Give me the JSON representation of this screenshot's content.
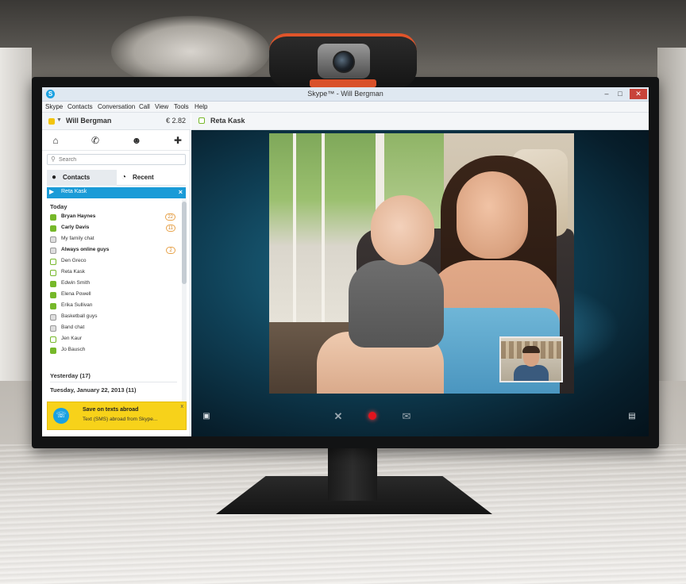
{
  "window": {
    "title": "Skype™ - Will Bergman",
    "app_icon": "skype-icon",
    "buttons": {
      "minimize": "–",
      "maximize": "□",
      "close": "✕"
    }
  },
  "menu": [
    "Skype",
    "Contacts",
    "Conversation",
    "Call",
    "View",
    "Tools",
    "Help"
  ],
  "profile": {
    "name": "Will Bergman",
    "credit": "€ 2.82",
    "status_color": "#f2c40d"
  },
  "toolbar_icons": [
    "home-icon",
    "phone-icon",
    "group-icon",
    "add-contact-icon"
  ],
  "search": {
    "placeholder": "Search"
  },
  "tabs": {
    "contacts": "Contacts",
    "recent": "Recent"
  },
  "active_chat": {
    "name": "Reta Kask"
  },
  "sections": {
    "today": "Today",
    "yesterday": "Yesterday (17)",
    "date1": "Tuesday, January 22, 2013 (11)"
  },
  "contacts": [
    {
      "name": "Bryan Haynes",
      "bold": true,
      "badge": "22",
      "kind": "online"
    },
    {
      "name": "Carly Davis",
      "bold": true,
      "badge": "11",
      "kind": "online"
    },
    {
      "name": "My family chat",
      "bold": false,
      "badge": "",
      "kind": "group"
    },
    {
      "name": "Always online guys",
      "bold": true,
      "badge": "2",
      "kind": "group"
    },
    {
      "name": "Den Greco",
      "bold": false,
      "badge": "",
      "kind": "away"
    },
    {
      "name": "Reta Kask",
      "bold": false,
      "badge": "",
      "kind": "away"
    },
    {
      "name": "Edwin Smith",
      "bold": false,
      "badge": "",
      "kind": "online"
    },
    {
      "name": "Elena Powell",
      "bold": false,
      "badge": "",
      "kind": "online"
    },
    {
      "name": "Erika Sullivan",
      "bold": false,
      "badge": "",
      "kind": "online"
    },
    {
      "name": "Basketball guys",
      "bold": false,
      "badge": "",
      "kind": "group"
    },
    {
      "name": "Band chat",
      "bold": false,
      "badge": "",
      "kind": "group"
    },
    {
      "name": "Jen Kaur",
      "bold": false,
      "badge": "",
      "kind": "away"
    },
    {
      "name": "Jo Bausch",
      "bold": false,
      "badge": "",
      "kind": "online"
    }
  ],
  "promo": {
    "title": "Save on texts abroad",
    "text": "Text (SMS) abroad from Skype...",
    "close": "x"
  },
  "conversation": {
    "name": "Reta Kask"
  },
  "call_controls": [
    "screen-share-icon",
    "hang-up-icon",
    "record-icon",
    "message-icon",
    "fullscreen-icon"
  ],
  "colors": {
    "accent": "#1a9bd7",
    "promo": "#f7d21a",
    "record": "#e3141e",
    "online": "#76b82a"
  }
}
